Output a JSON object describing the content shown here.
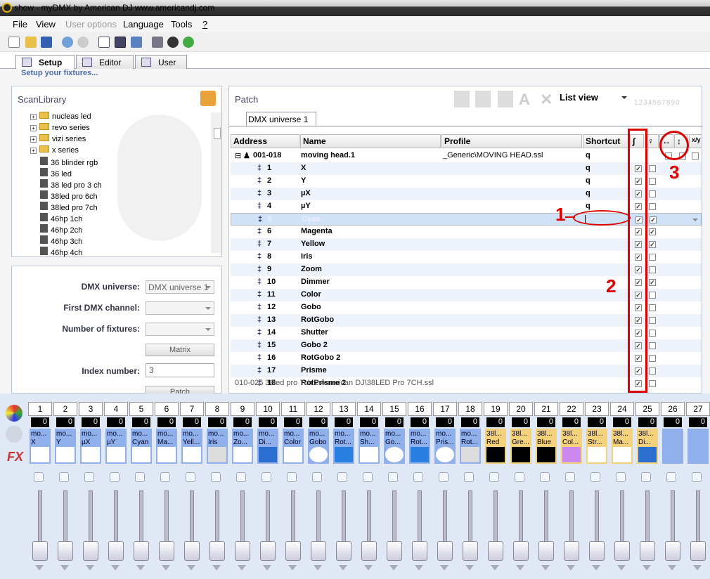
{
  "window": {
    "title": "show - myDMX    by American DJ    www.americandj.com"
  },
  "menu": [
    "File",
    "View",
    "User options",
    "Language",
    "Tools",
    "?"
  ],
  "tabs": [
    "Setup",
    "Editor",
    "User"
  ],
  "setup_hint": "Setup your fixtures...",
  "scanlibrary": {
    "title": "ScanLibrary",
    "items": [
      {
        "label": "nucleas led",
        "type": "folder"
      },
      {
        "label": "revo series",
        "type": "folder"
      },
      {
        "label": "vizi series",
        "type": "folder"
      },
      {
        "label": "x series",
        "type": "folder"
      },
      {
        "label": "36 blinder rgb",
        "type": "fixture"
      },
      {
        "label": "36 led",
        "type": "fixture"
      },
      {
        "label": "38 led pro 3 ch",
        "type": "fixture"
      },
      {
        "label": "38led pro 6ch",
        "type": "fixture"
      },
      {
        "label": "38led pro 7ch",
        "type": "fixture"
      },
      {
        "label": "46hp 1ch",
        "type": "fixture"
      },
      {
        "label": "46hp 2ch",
        "type": "fixture"
      },
      {
        "label": "46hp 3ch",
        "type": "fixture"
      },
      {
        "label": "46hp 4ch",
        "type": "fixture"
      }
    ]
  },
  "form": {
    "universe_label": "DMX universe:",
    "universe_value": "DMX universe 1",
    "first_channel_label": "First DMX channel:",
    "num_fixtures_label": "Number of fixtures:",
    "matrix": "Matrix",
    "index_label": "Index number:",
    "index_value": "3",
    "patch": "Patch"
  },
  "patch": {
    "title": "Patch",
    "view": "List view",
    "universe_tab": "DMX universe 1",
    "dip": "1234567890",
    "columns": [
      "Address",
      "Name",
      "Profile",
      "Shortcut"
    ],
    "fixture": {
      "address": "001-018",
      "name": "moving head.1",
      "profile": "_Generic\\MOVING HEAD.ssl",
      "shortcut": "q"
    },
    "channels": [
      {
        "n": "1",
        "name": "X",
        "shortcut": "q",
        "fade": true,
        "bright": false
      },
      {
        "n": "2",
        "name": "Y",
        "shortcut": "q",
        "fade": true,
        "bright": false
      },
      {
        "n": "3",
        "name": "µX",
        "shortcut": "q",
        "fade": true,
        "bright": false
      },
      {
        "n": "4",
        "name": "µY",
        "shortcut": "q",
        "fade": true,
        "bright": false
      },
      {
        "n": "5",
        "name": "Cyan",
        "shortcut": "",
        "fade": true,
        "bright": true
      },
      {
        "n": "6",
        "name": "Magenta",
        "shortcut": "",
        "fade": true,
        "bright": true
      },
      {
        "n": "7",
        "name": "Yellow",
        "shortcut": "",
        "fade": true,
        "bright": true
      },
      {
        "n": "8",
        "name": "Iris",
        "shortcut": "",
        "fade": true,
        "bright": false
      },
      {
        "n": "9",
        "name": "Zoom",
        "shortcut": "",
        "fade": true,
        "bright": false
      },
      {
        "n": "10",
        "name": "Dimmer",
        "shortcut": "",
        "fade": true,
        "bright": true
      },
      {
        "n": "11",
        "name": "Color",
        "shortcut": "",
        "fade": true,
        "bright": false
      },
      {
        "n": "12",
        "name": "Gobo",
        "shortcut": "",
        "fade": true,
        "bright": false
      },
      {
        "n": "13",
        "name": "RotGobo",
        "shortcut": "",
        "fade": true,
        "bright": false
      },
      {
        "n": "14",
        "name": "Shutter",
        "shortcut": "",
        "fade": true,
        "bright": false
      },
      {
        "n": "15",
        "name": "Gobo 2",
        "shortcut": "",
        "fade": true,
        "bright": false
      },
      {
        "n": "16",
        "name": "RotGobo 2",
        "shortcut": "",
        "fade": true,
        "bright": false
      },
      {
        "n": "17",
        "name": "Prisme",
        "shortcut": "",
        "fade": true,
        "bright": false
      },
      {
        "n": "18",
        "name": "RotPrisme 2",
        "shortcut": "",
        "fade": true,
        "bright": false
      }
    ],
    "next_row": "010-025   38led pro 7ch.2     American DJ\\38LED Pro 7CH.ssl"
  },
  "annotations": [
    "1",
    "2",
    "3"
  ],
  "faders": [
    {
      "n": "1",
      "val": "0",
      "l1": "mo...",
      "l2": "X",
      "c": "b"
    },
    {
      "n": "2",
      "val": "0",
      "l1": "mo...",
      "l2": "Y",
      "c": "b"
    },
    {
      "n": "3",
      "val": "0",
      "l1": "mo...",
      "l2": "µX",
      "c": "b"
    },
    {
      "n": "4",
      "val": "0",
      "l1": "mo...",
      "l2": "µY",
      "c": "b"
    },
    {
      "n": "5",
      "val": "0",
      "l1": "mo...",
      "l2": "Cyan",
      "c": "b"
    },
    {
      "n": "6",
      "val": "0",
      "l1": "mo...",
      "l2": "Ma...",
      "c": "b"
    },
    {
      "n": "7",
      "val": "0",
      "l1": "mo...",
      "l2": "Yell...",
      "c": "b"
    },
    {
      "n": "8",
      "val": "0",
      "l1": "mo...",
      "l2": "Iris",
      "c": "b"
    },
    {
      "n": "9",
      "val": "0",
      "l1": "mo...",
      "l2": "Zo...",
      "c": "b"
    },
    {
      "n": "10",
      "val": "0",
      "l1": "mo...",
      "l2": "Di...",
      "c": "b"
    },
    {
      "n": "11",
      "val": "0",
      "l1": "mo...",
      "l2": "Color",
      "c": "b"
    },
    {
      "n": "12",
      "val": "0",
      "l1": "mo...",
      "l2": "Gobo",
      "c": "b"
    },
    {
      "n": "13",
      "val": "0",
      "l1": "mo...",
      "l2": "Rot...",
      "c": "b"
    },
    {
      "n": "14",
      "val": "0",
      "l1": "mo...",
      "l2": "Sh...",
      "c": "b"
    },
    {
      "n": "15",
      "val": "0",
      "l1": "mo...",
      "l2": "Go...",
      "c": "b"
    },
    {
      "n": "16",
      "val": "0",
      "l1": "mo...",
      "l2": "Rot...",
      "c": "b"
    },
    {
      "n": "17",
      "val": "0",
      "l1": "mo...",
      "l2": "Pris...",
      "c": "b"
    },
    {
      "n": "18",
      "val": "0",
      "l1": "mo...",
      "l2": "Rot...",
      "c": "b"
    },
    {
      "n": "19",
      "val": "0",
      "l1": "38l...",
      "l2": "Red",
      "c": "a"
    },
    {
      "n": "20",
      "val": "0",
      "l1": "38l...",
      "l2": "Gre...",
      "c": "a"
    },
    {
      "n": "21",
      "val": "0",
      "l1": "38l...",
      "l2": "Blue",
      "c": "a"
    },
    {
      "n": "22",
      "val": "0",
      "l1": "38l...",
      "l2": "Col...",
      "c": "a"
    },
    {
      "n": "23",
      "val": "0",
      "l1": "38l...",
      "l2": "Str...",
      "c": "a"
    },
    {
      "n": "24",
      "val": "0",
      "l1": "38l...",
      "l2": "Ma...",
      "c": "a"
    },
    {
      "n": "25",
      "val": "0",
      "l1": "38l...",
      "l2": "Di...",
      "c": "a"
    },
    {
      "n": "26",
      "val": "0",
      "l1": "",
      "l2": "",
      "c": "b"
    },
    {
      "n": "27",
      "val": "0",
      "l1": "",
      "l2": "",
      "c": "b"
    }
  ],
  "side_icons": [
    "colors-icon",
    "effects-icon"
  ],
  "side_fx_label": "FX"
}
